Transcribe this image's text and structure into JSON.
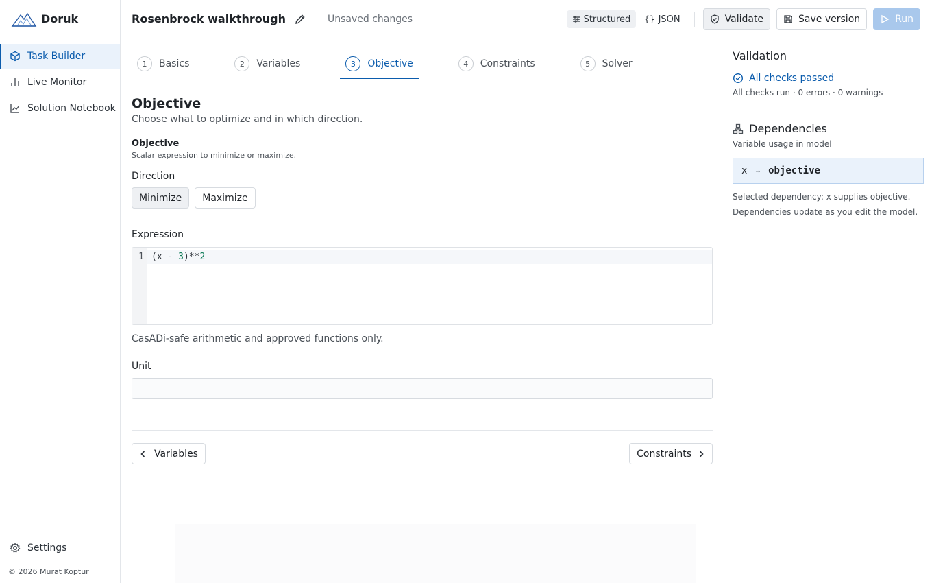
{
  "app": {
    "name": "Doruk"
  },
  "sidebar": {
    "items": [
      {
        "label": "Task Builder",
        "icon": "cube-icon",
        "active": true
      },
      {
        "label": "Live Monitor",
        "icon": "bar-chart-icon"
      },
      {
        "label": "Solution Notebook",
        "icon": "line-chart-icon"
      }
    ],
    "settings": "Settings",
    "copyright": "© 2026 Murat Koptur"
  },
  "header": {
    "title": "Rosenbrock walkthrough",
    "status": "Unsaved changes",
    "modes": [
      "Structured",
      "JSON"
    ],
    "active_mode": "Structured",
    "validate": "Validate",
    "save": "Save version",
    "run": "Run"
  },
  "steps": [
    {
      "num": "1",
      "label": "Basics"
    },
    {
      "num": "2",
      "label": "Variables"
    },
    {
      "num": "3",
      "label": "Objective",
      "active": true
    },
    {
      "num": "4",
      "label": "Constraints"
    },
    {
      "num": "5",
      "label": "Solver"
    }
  ],
  "form": {
    "heading": "Objective",
    "subheading": "Choose what to optimize and in which direction.",
    "section_title": "Objective",
    "section_sub": "Scalar expression to minimize or maximize.",
    "direction_label": "Direction",
    "direction_options": [
      "Minimize",
      "Maximize"
    ],
    "direction_selected": "Minimize",
    "expression_label": "Expression",
    "expression": {
      "line": "1",
      "code_a": "(x - ",
      "num_a": "3",
      "code_b": ")**",
      "num_b": "2"
    },
    "hint": "CasADi-safe arithmetic and approved functions only.",
    "unit_label": "Unit",
    "unit_value": "",
    "prev": "Variables",
    "next": "Constraints"
  },
  "validation": {
    "title": "Validation",
    "status": "All checks passed",
    "meta": "All checks run · 0 errors · 0 warnings"
  },
  "dependencies": {
    "title": "Dependencies",
    "subtitle": "Variable usage in model",
    "source": "x",
    "arrow": "→",
    "target": "objective",
    "selected_note": "Selected dependency: x supplies objective.",
    "update_note": "Dependencies update as you edit the model."
  },
  "colors": {
    "accent": "#0b5cad",
    "run_disabled": "#a9c8ec",
    "code_number": "#0a7a55"
  }
}
